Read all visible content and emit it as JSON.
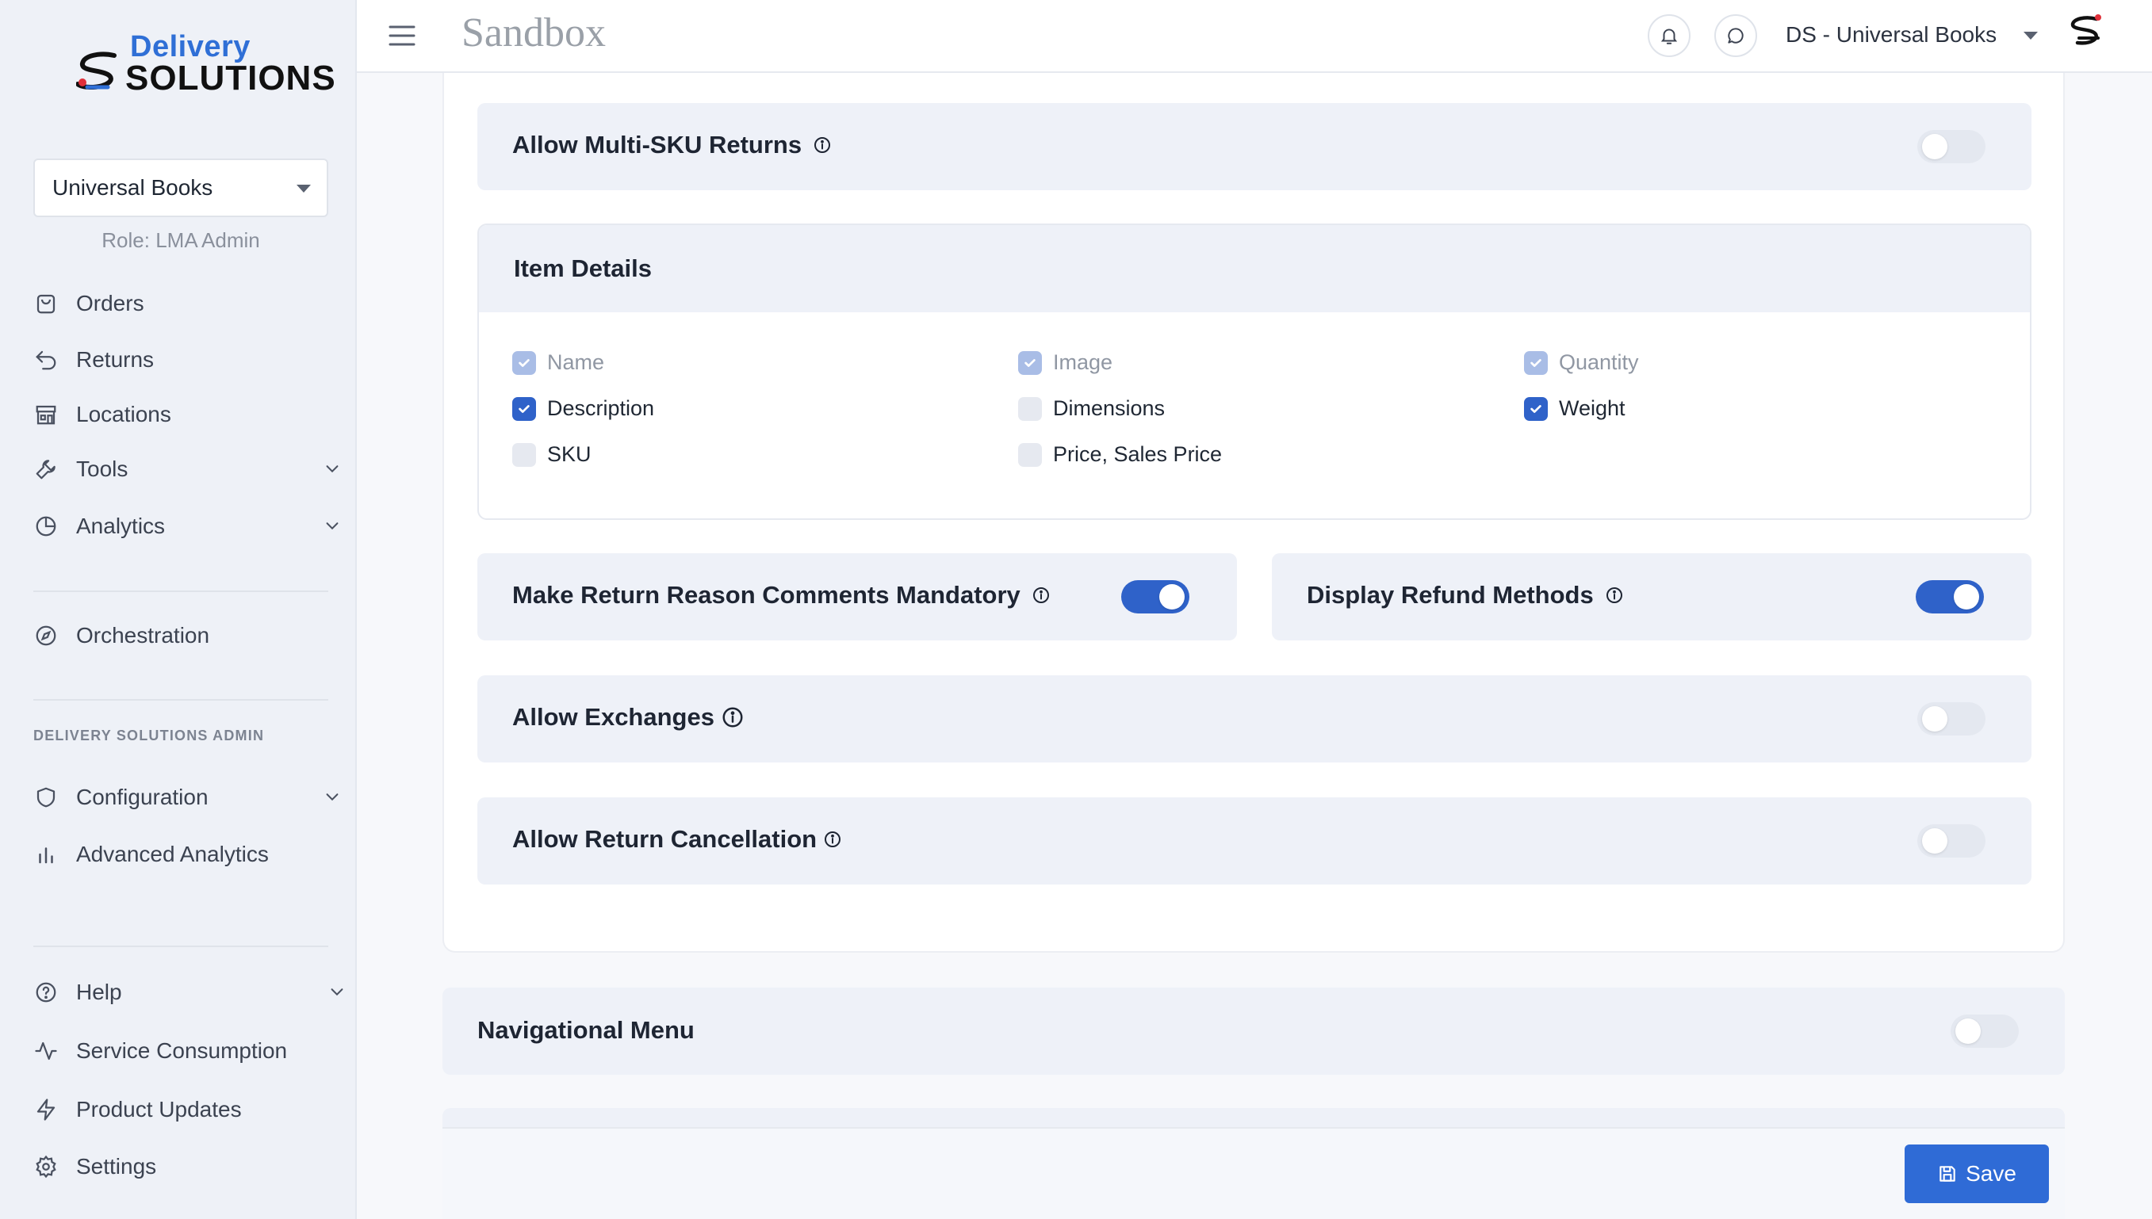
{
  "brand": {
    "logo_line1": "Delivery",
    "logo_line2": "SOLUTIONS",
    "environment": "Sandbox"
  },
  "sidebar": {
    "org_select": "Universal Books",
    "role": "Role: LMA Admin",
    "items": [
      {
        "label": "Orders",
        "icon": "shopping-bag-icon"
      },
      {
        "label": "Returns",
        "icon": "return-arrow-icon"
      },
      {
        "label": "Locations",
        "icon": "store-icon"
      },
      {
        "label": "Tools",
        "icon": "wrench-icon",
        "expandable": true
      },
      {
        "label": "Analytics",
        "icon": "pie-chart-icon",
        "expandable": true
      },
      {
        "label": "Orchestration",
        "icon": "compass-icon"
      }
    ],
    "admin_section_label": "DELIVERY SOLUTIONS ADMIN",
    "admin_items": [
      {
        "label": "Configuration",
        "icon": "shield-icon",
        "expandable": true
      },
      {
        "label": "Advanced Analytics",
        "icon": "bar-chart-icon"
      }
    ],
    "bottom_items": [
      {
        "label": "Help",
        "icon": "help-circle-icon",
        "expandable": true
      },
      {
        "label": "Service Consumption",
        "icon": "activity-icon"
      },
      {
        "label": "Product Updates",
        "icon": "lightning-icon"
      },
      {
        "label": "Settings",
        "icon": "gear-icon"
      }
    ]
  },
  "header": {
    "account": "DS - Universal Books"
  },
  "settings": {
    "multi_sku": {
      "label": "Allow Multi-SKU Returns",
      "enabled": false
    },
    "item_details": {
      "title": "Item Details",
      "fields": [
        {
          "label": "Name",
          "state": "checked-disabled"
        },
        {
          "label": "Image",
          "state": "checked-disabled"
        },
        {
          "label": "Quantity",
          "state": "checked-disabled"
        },
        {
          "label": "Description",
          "state": "checked"
        },
        {
          "label": "Dimensions",
          "state": "unchecked"
        },
        {
          "label": "Weight",
          "state": "checked"
        },
        {
          "label": "SKU",
          "state": "unchecked"
        },
        {
          "label": "Price, Sales Price",
          "state": "unchecked"
        }
      ]
    },
    "return_reason": {
      "label": "Make Return Reason Comments Mandatory",
      "enabled": true
    },
    "refund_methods": {
      "label": "Display Refund Methods",
      "enabled": true
    },
    "exchanges": {
      "label": "Allow Exchanges",
      "enabled": false
    },
    "cancellation": {
      "label": "Allow Return Cancellation",
      "enabled": false
    },
    "nav_menu": {
      "label": "Navigational Menu",
      "enabled": false
    }
  },
  "footer": {
    "save_label": "Save"
  },
  "colors": {
    "accent": "#2f62c9",
    "panel": "#eef1f8",
    "sidebar": "#eef1f7"
  }
}
